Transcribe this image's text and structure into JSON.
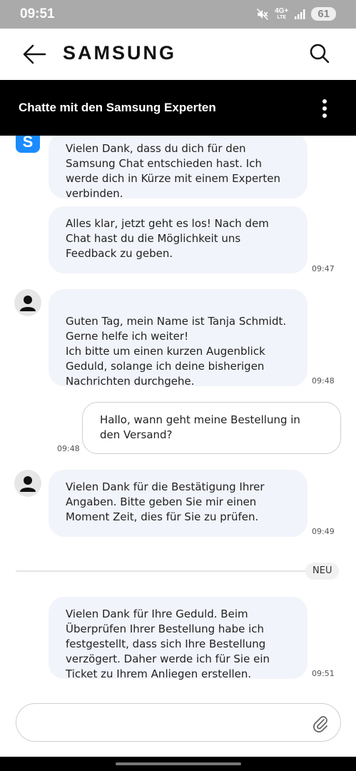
{
  "status_bar": {
    "time": "09:51",
    "network_top": "4G+",
    "network_bottom": "LTE",
    "battery": "61",
    "icons": [
      "mute-icon",
      "signal-icon"
    ]
  },
  "app_bar": {
    "logo": "SAMSUNG",
    "icons": [
      "back-arrow-icon",
      "search-icon"
    ]
  },
  "chat_header": {
    "title": "Chatte mit den Samsung Experten",
    "menu_icon": "more-vertical-icon"
  },
  "bot_icon_letter": "S",
  "messages": [
    {
      "sender": "bot",
      "text": "Vielen Dank, dass du dich für den Samsung Chat entschieden hast. Ich werde dich in Kürze mit einem Experten verbinden.",
      "time": ""
    },
    {
      "sender": "bot",
      "text": "Alles klar, jetzt geht es los! Nach dem Chat hast du die Möglichkeit uns Feedback zu geben.",
      "time": "09:47"
    },
    {
      "sender": "agent",
      "text": "Guten Tag, mein Name ist Tanja Schmidt.\nGerne helfe ich weiter!\nIch bitte um einen kurzen Augenblick Geduld, solange ich deine bisherigen Nachrichten durchgehe.",
      "time": "09:48"
    },
    {
      "sender": "user",
      "text": "Hallo, wann geht meine Bestellung in den Versand?",
      "time": "09:48"
    },
    {
      "sender": "agent",
      "text": "Vielen Dank für die Bestätigung Ihrer Angaben. Bitte geben Sie mir einen Moment Zeit, dies für Sie zu prüfen.",
      "time": "09:49"
    },
    {
      "sender": "agent",
      "text": "Vielen Dank für Ihre Geduld. Beim Überprüfen Ihrer Bestellung habe ich festgestellt, dass sich Ihre Bestellung verzögert. Daher werde ich für Sie ein Ticket zu Ihrem Anliegen erstellen.",
      "time": "09:51"
    }
  ],
  "new_divider_label": "NEU",
  "composer": {
    "value": "",
    "placeholder": "",
    "attach_icon": "paperclip-icon"
  },
  "colors": {
    "header_bg": "#000000",
    "bubble_bg": "#f2f4fb",
    "bot_icon": "#1a8cff",
    "status_bar_bg": "#aaaaaa"
  }
}
